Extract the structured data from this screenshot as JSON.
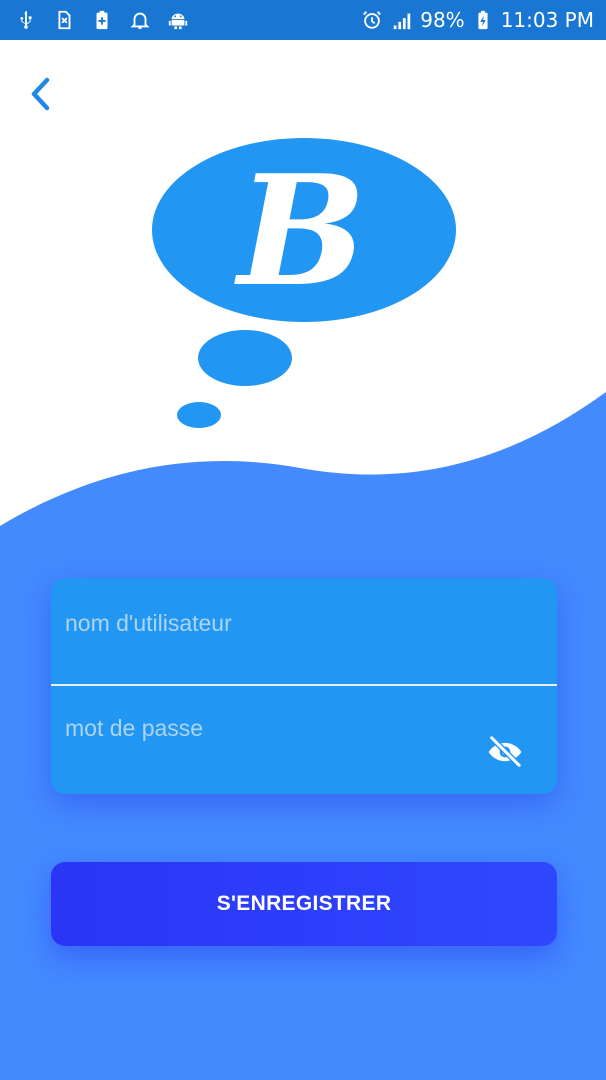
{
  "status_bar": {
    "left_icons": [
      "usb-icon",
      "sim-icon",
      "battery-plus-icon",
      "notification-bell-icon",
      "android-icon"
    ],
    "battery_percent": "98%",
    "time": "11:03 PM"
  },
  "nav": {
    "back_icon": "chevron-left-icon"
  },
  "logo": {
    "letter": "B",
    "icon": "thought-bubble-logo"
  },
  "form": {
    "username": {
      "placeholder": "nom d'utilisateur",
      "value": ""
    },
    "password": {
      "placeholder": "mot de passe",
      "value": "",
      "toggle_icon": "eye-off-icon"
    }
  },
  "actions": {
    "register_label": "S'ENREGISTRER"
  },
  "colors": {
    "status_bar": "#1976d2",
    "background_wave": "#448aff",
    "field_card": "#2196f3",
    "logo_blue": "#2196f3",
    "button": "#2f3ffb",
    "back_arrow": "#1e88e5"
  }
}
